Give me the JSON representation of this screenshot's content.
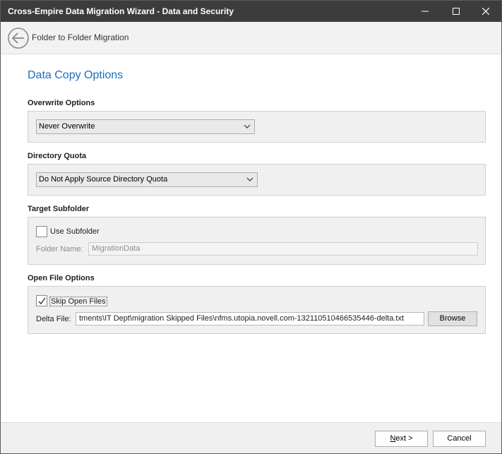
{
  "window": {
    "title": "Cross-Empire Data Migration Wizard  -  Data and Security",
    "minimize_icon": "minimize-icon",
    "maximize_icon": "maximize-icon",
    "close_icon": "close-icon"
  },
  "nav": {
    "back_icon": "back-arrow-circle-icon",
    "title": "Folder to Folder Migration"
  },
  "page": {
    "title": "Data Copy Options"
  },
  "overwrite": {
    "label": "Overwrite Options",
    "selected": "Never Overwrite"
  },
  "quota": {
    "label": "Directory Quota",
    "selected": "Do Not Apply Source Directory Quota"
  },
  "subfolder": {
    "label": "Target Subfolder",
    "use_label": "Use Subfolder",
    "use_checked": false,
    "folder_name_label": "Folder Name:",
    "folder_name_value": "MigrationData"
  },
  "open_files": {
    "label": "Open File Options",
    "skip_label": "Skip Open Files",
    "skip_checked": true,
    "delta_label": "Delta File:",
    "delta_value": "tments\\IT Dept\\migration Skipped Files\\nfms.utopia.novell.com-132110510466535446-delta.txt",
    "browse_label": "Browse"
  },
  "footer": {
    "next_label": "Next >",
    "next_mnemonic": "N",
    "next_rest": "ext >",
    "cancel_label": "Cancel"
  },
  "colors": {
    "titlebar": "#3c3c3c",
    "accent": "#1a6fbd",
    "group_bg": "#f0f0f0"
  }
}
